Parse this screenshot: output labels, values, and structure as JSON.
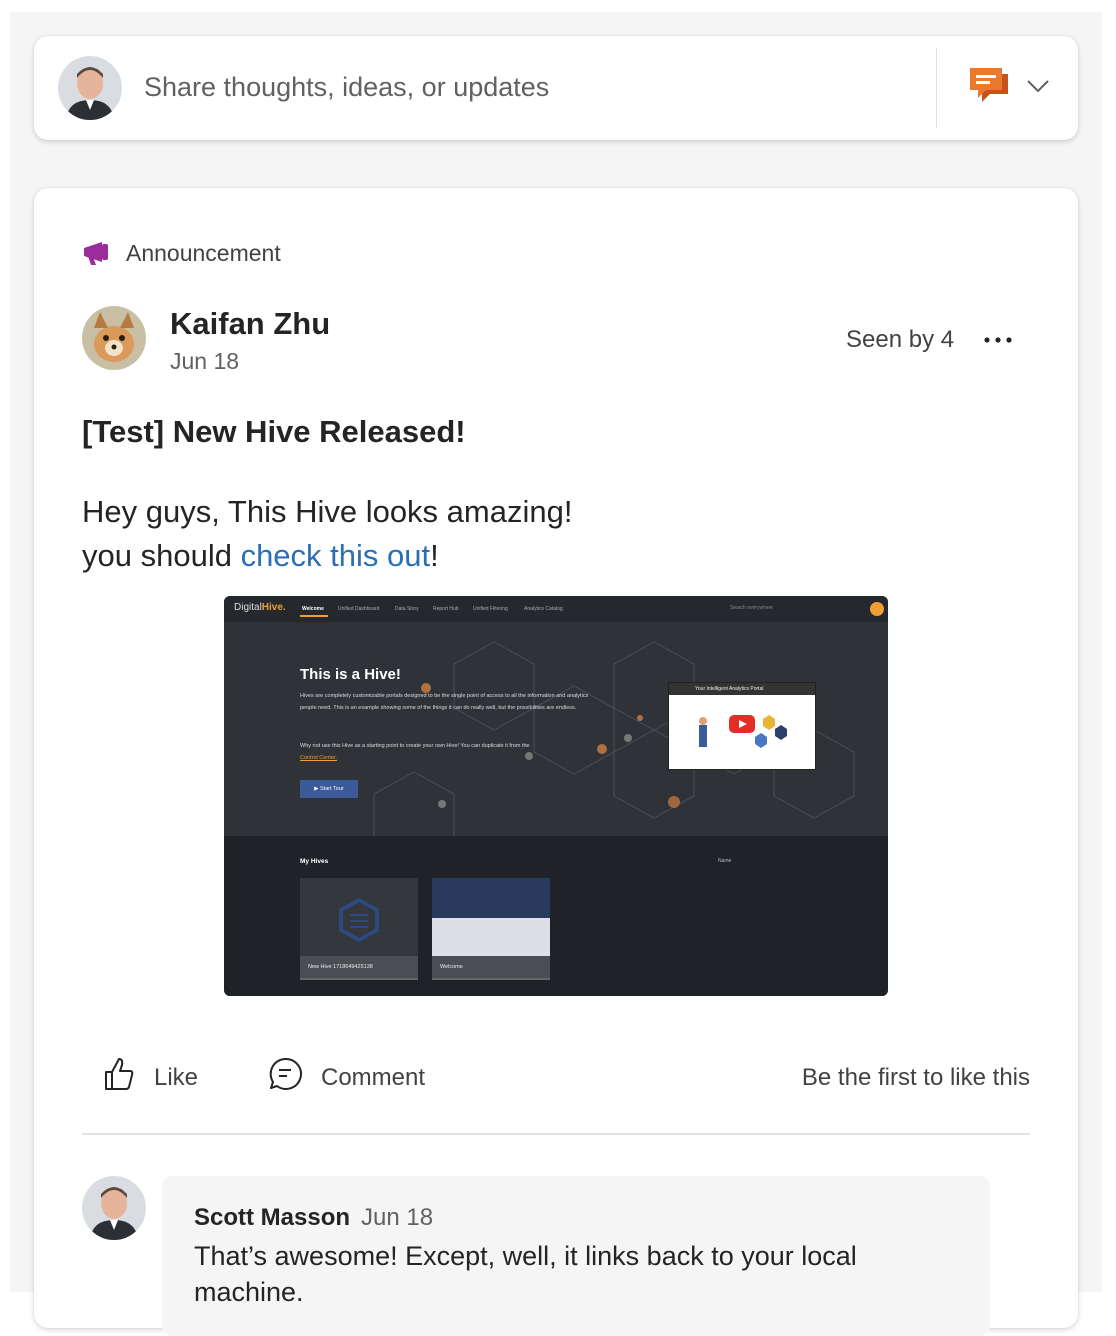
{
  "composer": {
    "placeholder": "Share thoughts, ideas, or updates",
    "post_type_icon": "chat-bubbles-icon",
    "dropdown_icon": "chevron-down-icon",
    "accent_color": "#e1651f"
  },
  "post": {
    "type_label": "Announcement",
    "type_icon": "megaphone-icon",
    "type_color": "#9c2b9c",
    "author": "Kaifan Zhu",
    "date": "Jun 18",
    "seen_by": "Seen by 4",
    "title": "[Test] New Hive Released!",
    "body_line1": "Hey guys, This Hive looks amazing!",
    "body_line2_prefix": "you should ",
    "body_link": "check this out",
    "body_line2_suffix": "!",
    "link_color": "#2b6fb4",
    "image": {
      "logo_a": "Digital",
      "logo_b": "Hive.",
      "nav": [
        "Welcome",
        "Unified Dashboard",
        "Data Story",
        "Report Hub",
        "Unified Filtering",
        "Analytics Catalog"
      ],
      "search_placeholder": "Search everywhere",
      "user_initials": "AD",
      "heading": "This is a Hive!",
      "para1": "Hives are completely customizable portals designed to be the single point of access to all the information and analytics people need. This is an example showing some of the things it can do really well, but the possibilities are endless.",
      "para2": "Why not use this Hive as a starting point to create your own Hive! You can duplicate it from the",
      "para2_link": "Control Center.",
      "tour_button": "▶  Start Tour",
      "video_title": "Your Intelligent Analytics Portal",
      "my_hives": "My Hives",
      "sort_label": "Name",
      "cards": [
        "New Hive 1718649425138",
        "Welcome"
      ]
    }
  },
  "actions": {
    "like": "Like",
    "comment": "Comment",
    "like_status": "Be the first to like this"
  },
  "comment": {
    "author": "Scott Masson",
    "date": "Jun 18",
    "text": "That’s awesome! Except, well, it links back to your local machine."
  }
}
